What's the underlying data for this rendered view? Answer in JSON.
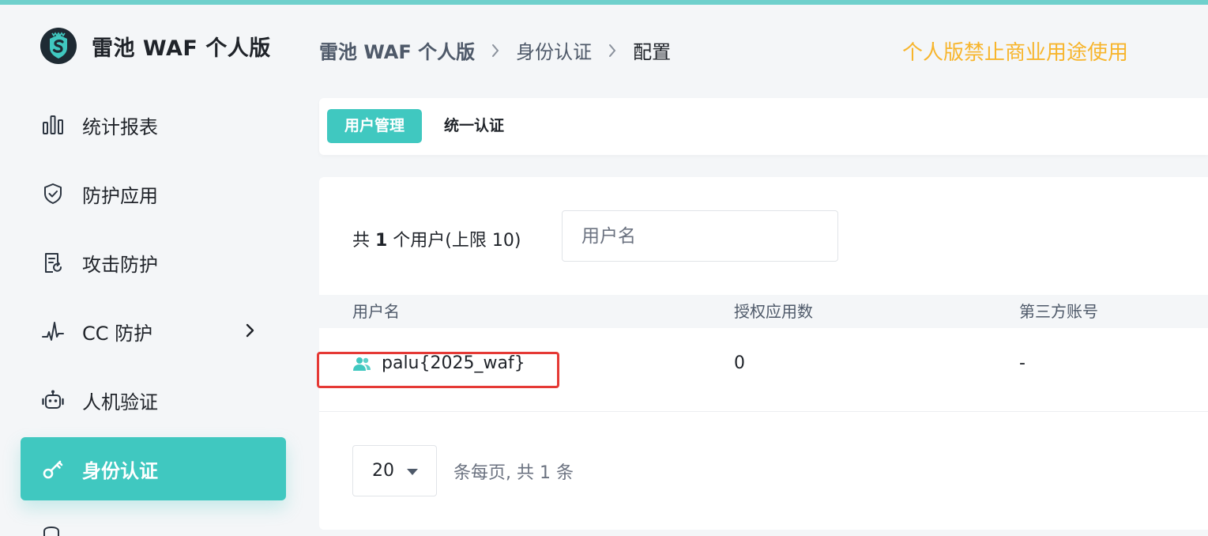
{
  "app": {
    "title": "雷池 WAF 个人版",
    "notice": "个人版禁止商业用途使用",
    "colors": {
      "accent": "#40c8c0",
      "top_bar": "#6fd0cc",
      "notice": "#f7b52c",
      "highlight": "#e53935"
    }
  },
  "sidebar": {
    "items": [
      {
        "label": "统计报表",
        "icon": "bar-chart-icon"
      },
      {
        "label": "防护应用",
        "icon": "shield-check-icon"
      },
      {
        "label": "攻击防护",
        "icon": "document-refresh-icon"
      },
      {
        "label": "CC 防护",
        "icon": "pulse-icon",
        "has_submenu": true
      },
      {
        "label": "人机验证",
        "icon": "robot-icon"
      },
      {
        "label": "身份认证",
        "icon": "key-icon",
        "active": true
      }
    ]
  },
  "breadcrumb": {
    "items": [
      "雷池 WAF 个人版",
      "身份认证",
      "配置"
    ]
  },
  "tabs": [
    {
      "label": "用户管理",
      "active": true
    },
    {
      "label": "统一认证",
      "active": false
    }
  ],
  "users": {
    "summary_prefix": "共 ",
    "count": "1",
    "summary_suffix": " 个用户(上限 10)",
    "search_placeholder": "用户名",
    "columns": [
      "用户名",
      "授权应用数",
      "第三方账号"
    ],
    "rows": [
      {
        "username": "palu{2025_waf}",
        "apps": "0",
        "third_party": "-"
      }
    ]
  },
  "pagination": {
    "page_size": "20",
    "summary": "条每页, 共 1 条"
  }
}
